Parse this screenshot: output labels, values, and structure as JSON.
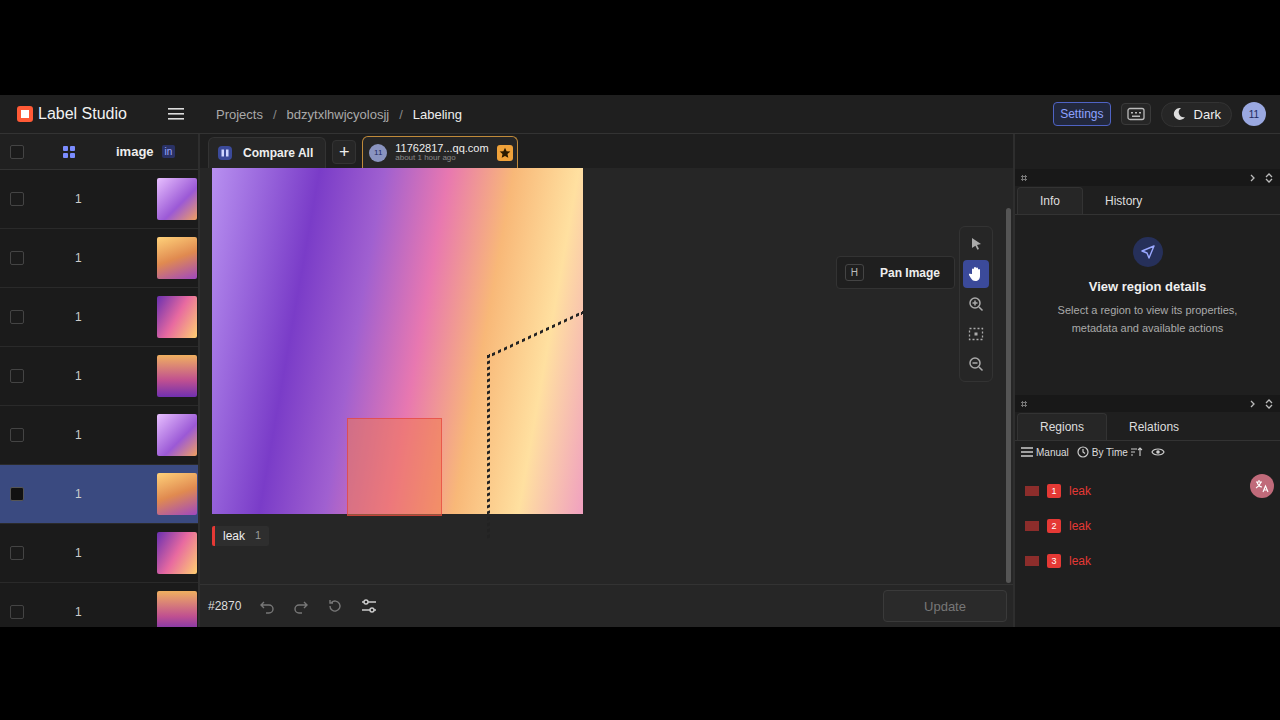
{
  "app": {
    "name": "Label Studio"
  },
  "header": {
    "breadcrumb": [
      "Projects",
      "bdzytxlhwjcyolosjj",
      "Labeling"
    ],
    "separator": "/",
    "settings": "Settings",
    "theme": "Dark",
    "avatar": "11"
  },
  "table": {
    "columns": [
      {
        "label": "image"
      },
      {
        "label": "in"
      }
    ],
    "rows": [
      {
        "value": "1",
        "selected": false
      },
      {
        "value": "1",
        "selected": false
      },
      {
        "value": "1",
        "selected": false
      },
      {
        "value": "1",
        "selected": false
      },
      {
        "value": "1",
        "selected": false
      },
      {
        "value": "1",
        "selected": true
      },
      {
        "value": "1",
        "selected": false
      },
      {
        "value": "1",
        "selected": false
      }
    ]
  },
  "annotation_bar": {
    "compare": "Compare All",
    "add": "+",
    "tab": {
      "avatar": "11",
      "user": "11762817...qq.com",
      "time": "about 1 hour ago",
      "starred": true
    }
  },
  "tooltip": {
    "key": "H",
    "label": "Pan Image"
  },
  "tools": [
    {
      "kind": "select",
      "selected": false
    },
    {
      "kind": "pan",
      "selected": true
    },
    {
      "kind": "zoom-in",
      "selected": false
    },
    {
      "kind": "fit",
      "selected": false
    },
    {
      "kind": "zoom-out",
      "selected": false
    }
  ],
  "labels": [
    {
      "label": "leak",
      "count": "1",
      "color": "#e53935"
    }
  ],
  "bottom_bar": {
    "task_id": "#2870",
    "update": "Update",
    "update_disabled": true
  },
  "info_panel": {
    "tabs": [
      {
        "label": "Info",
        "selected": true
      },
      {
        "label": "History",
        "selected": false
      }
    ],
    "title": "View region details",
    "description": "Select a region to view its properties, metadata and available actions"
  },
  "regions_panel": {
    "tabs": [
      {
        "label": "Regions",
        "selected": true
      },
      {
        "label": "Relations",
        "selected": false
      }
    ],
    "sort": {
      "mode": "Manual",
      "order": "By Time"
    },
    "regions": [
      {
        "index": "1",
        "label": "leak",
        "color": "#e53935"
      },
      {
        "index": "2",
        "label": "leak",
        "color": "#e53935"
      },
      {
        "index": "3",
        "label": "leak",
        "color": "#e53935"
      }
    ]
  }
}
